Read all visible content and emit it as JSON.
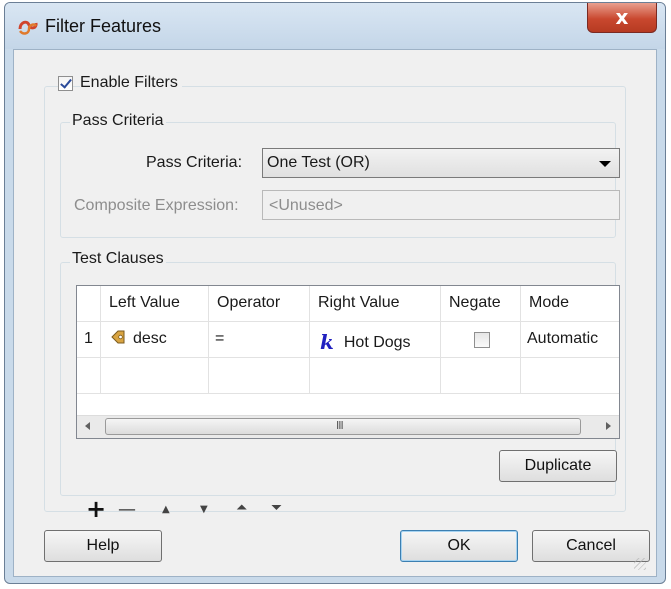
{
  "window": {
    "title": "Filter Features",
    "close_glyph": "x"
  },
  "enable_filters": {
    "label": "Enable Filters",
    "checked": true
  },
  "pass_criteria": {
    "group_label": "Pass Criteria",
    "field_label": "Pass Criteria:",
    "value": "One Test (OR)",
    "composite_label": "Composite Expression:",
    "composite_value": "<Unused>"
  },
  "test_clauses": {
    "group_label": "Test Clauses",
    "columns": [
      "Left Value",
      "Operator",
      "Right Value",
      "Negate",
      "Mode"
    ],
    "rows": [
      {
        "num": "1",
        "left_value": "desc",
        "operator": "=",
        "right_value": "Hot Dogs",
        "negate": false,
        "mode": "Automatic"
      }
    ],
    "scroll_grip": "III"
  },
  "toolbar": {
    "add": "+",
    "remove": "—",
    "up": "▲",
    "down": "▼",
    "top": "⏶",
    "bottom": "⏷",
    "duplicate": "Duplicate"
  },
  "buttons": {
    "help": "Help",
    "ok": "OK",
    "cancel": "Cancel"
  },
  "icons": {
    "app": "fme-workbench-icon",
    "attribute": "attribute-icon",
    "constant": "constant-k-icon"
  }
}
